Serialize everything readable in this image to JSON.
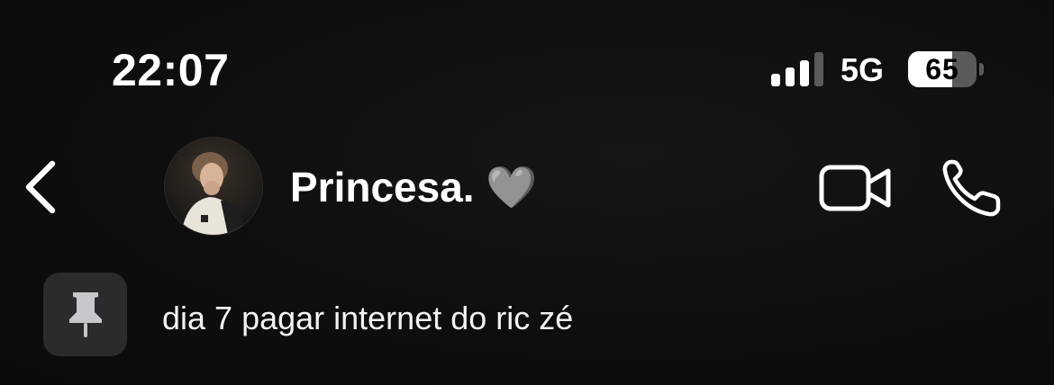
{
  "status_bar": {
    "time": "22:07",
    "network": "5G",
    "battery_percent": "65",
    "battery_level": 0.65,
    "signal_bars_active": 3,
    "signal_bars_total": 4
  },
  "header": {
    "back_icon": "chevron-left-icon",
    "contact_name": "Princesa. 🩶",
    "video_icon": "video-camera-icon",
    "call_icon": "phone-icon"
  },
  "pinned_message": {
    "icon": "pin-icon",
    "text": "dia 7 pagar internet do ric zé"
  },
  "colors": {
    "background": "#0d0d0d",
    "text": "#ffffff",
    "pin_box": "#2b2b2d"
  }
}
